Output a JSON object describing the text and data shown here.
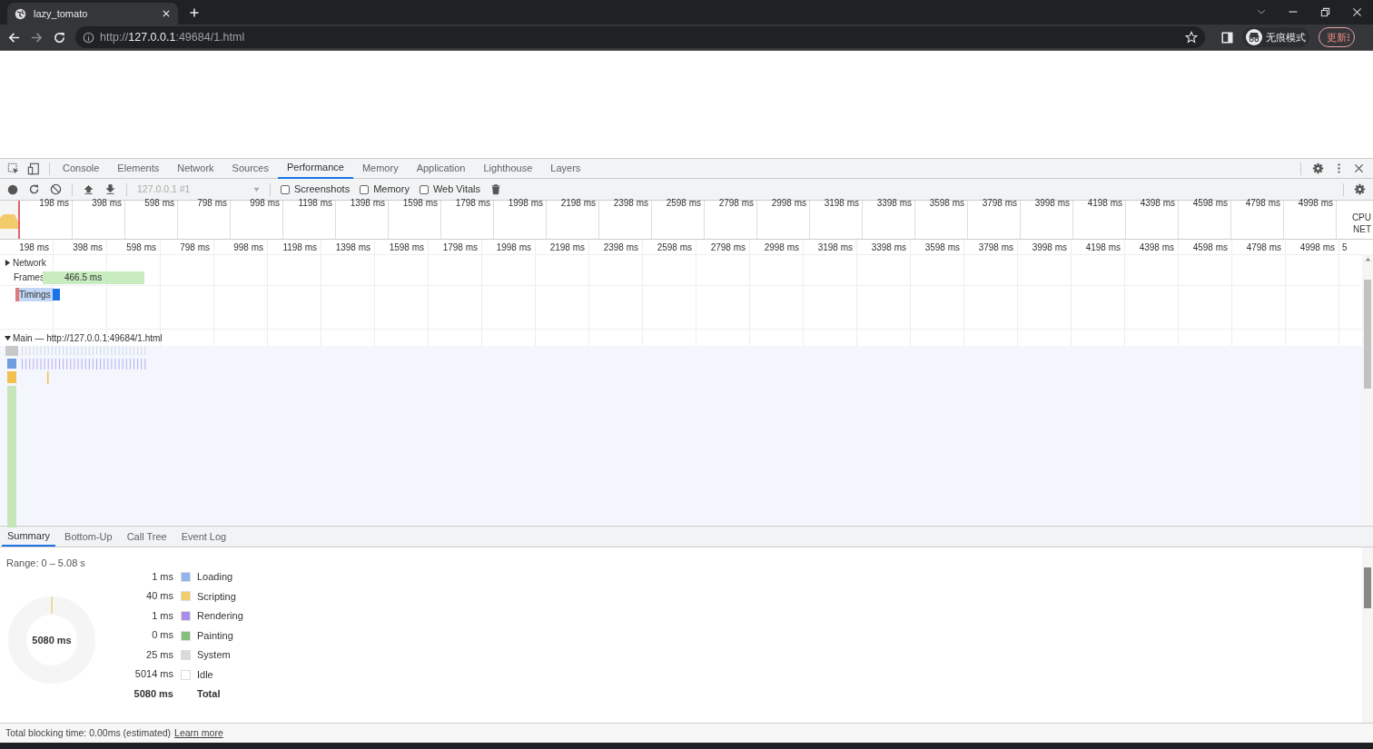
{
  "browser": {
    "tabs": [
      {
        "title": "lazy_tomato",
        "selected": true
      }
    ],
    "url": {
      "scheme": "http://",
      "host": "127.0.0.1",
      "rest": ":49684/1.html"
    },
    "profile": "无痕模式",
    "update": "更新"
  },
  "devtools": {
    "tabs": [
      {
        "label": "Console",
        "selected": false
      },
      {
        "label": "Elements",
        "selected": false
      },
      {
        "label": "Network",
        "selected": false
      },
      {
        "label": "Sources",
        "selected": false
      },
      {
        "label": "Performance",
        "selected": true
      },
      {
        "label": "Memory",
        "selected": false
      },
      {
        "label": "Application",
        "selected": false
      },
      {
        "label": "Lighthouse",
        "selected": false
      },
      {
        "label": "Layers",
        "selected": false
      }
    ],
    "toolbar": {
      "recording": "127.0.0.1 #1",
      "checkboxes": [
        {
          "label": "Screenshots",
          "checked": false
        },
        {
          "label": "Memory",
          "checked": false
        },
        {
          "label": "Web Vitals",
          "checked": false
        }
      ]
    },
    "overview": {
      "ticks": [
        "198 ms",
        "398 ms",
        "598 ms",
        "798 ms",
        "998 ms",
        "1198 ms",
        "1398 ms",
        "1598 ms",
        "1798 ms",
        "1998 ms",
        "2198 ms",
        "2398 ms",
        "2598 ms",
        "2798 ms",
        "2998 ms",
        "3198 ms",
        "3398 ms",
        "3598 ms",
        "3798 ms",
        "3998 ms",
        "4198 ms",
        "4398 ms",
        "4598 ms",
        "4798 ms",
        "4998 ms"
      ],
      "lanes": [
        "CPU",
        "NET"
      ]
    },
    "ruler": {
      "ticks": [
        "198 ms",
        "398 ms",
        "598 ms",
        "798 ms",
        "998 ms",
        "1198 ms",
        "1398 ms",
        "1598 ms",
        "1798 ms",
        "1998 ms",
        "2198 ms",
        "2398 ms",
        "2598 ms",
        "2798 ms",
        "2998 ms",
        "3198 ms",
        "3398 ms",
        "3598 ms",
        "3798 ms",
        "3998 ms",
        "4198 ms",
        "4398 ms",
        "4598 ms",
        "4798 ms",
        "4998 ms",
        "5"
      ]
    },
    "tracks": [
      {
        "kind": "group",
        "label": "Network",
        "expanded": false
      },
      {
        "kind": "frames",
        "label": "Frames",
        "value": "466.5 ms"
      },
      {
        "kind": "timings",
        "label": "Timings"
      },
      {
        "kind": "main",
        "label": "Main — http://127.0.0.1:49684/1.html",
        "expanded": true
      }
    ],
    "detail_tabs": [
      {
        "label": "Summary",
        "selected": true
      },
      {
        "label": "Bottom-Up",
        "selected": false
      },
      {
        "label": "Call Tree",
        "selected": false
      },
      {
        "label": "Event Log",
        "selected": false
      }
    ],
    "summary": {
      "range": "Range: 0 – 5.08 s",
      "center": "5080 ms",
      "items": [
        {
          "value": "1 ms",
          "label": "Loading",
          "color": "#8fb5ec"
        },
        {
          "value": "40 ms",
          "label": "Scripting",
          "color": "#f2cc6b"
        },
        {
          "value": "1 ms",
          "label": "Rendering",
          "color": "#a88ee8"
        },
        {
          "value": "0 ms",
          "label": "Painting",
          "color": "#86bf7c"
        },
        {
          "value": "25 ms",
          "label": "System",
          "color": "#dadada"
        },
        {
          "value": "5014 ms",
          "label": "Idle",
          "color": "#ffffff"
        }
      ],
      "total": {
        "value": "5080 ms",
        "label": "Total"
      }
    },
    "footer": {
      "text": "Total blocking time: 0.00ms (estimated)",
      "link": "Learn more"
    }
  }
}
